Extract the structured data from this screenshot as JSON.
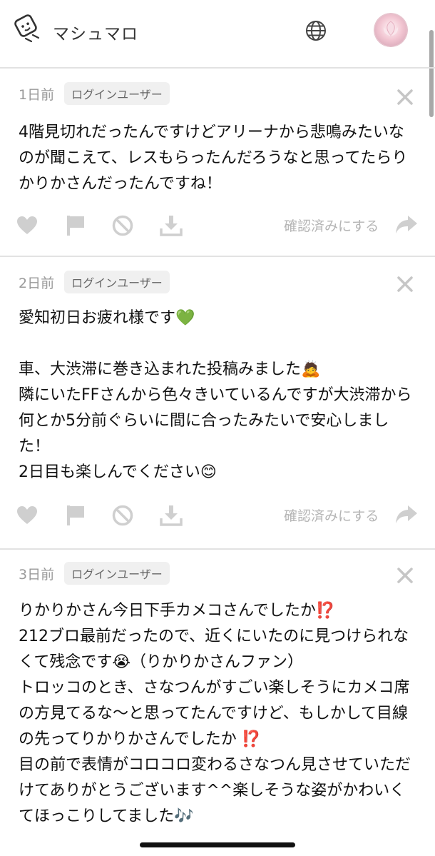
{
  "app": {
    "title": "マシュマロ"
  },
  "messages": [
    {
      "time": "1日前",
      "badge": "ログインユーザー",
      "text": "4階見切れだったんですけどアリーナから悲鳴みたいなのが聞こえて、レスもらったんだろうなと思ってたらりかりかさんだったんですね！",
      "confirm_label": "確認済みにする"
    },
    {
      "time": "2日前",
      "badge": "ログインユーザー",
      "text": "愛知初日お疲れ様です💚\n\n車、大渋滞に巻き込まれた投稿みました🙇\n隣にいたFFさんから色々きいているんですが大渋滞から何とか5分前ぐらいに間に合ったみたいで安心しました！\n2日目も楽しんでください😊",
      "confirm_label": "確認済みにする"
    },
    {
      "time": "3日前",
      "badge": "ログインユーザー",
      "text": "りかりかさん今日下手カメコさんでしたか⁉️\n212ブロ最前だったので、近くにいたのに見つけられなくて残念です😭（りかりかさんファン）\nトロッコのとき、さなつんがすごい楽しそうにカメコ席の方見てるな〜と思ってたんですけど、もしかして目線の先ってりかりかさんでしたか ⁉️\n目の前で表情がコロコロ変わるさなつん見させていただけてありがとうございます^^楽しそうな姿がかわいくてほっこりしてました🎶",
      "confirm_label": ""
    }
  ],
  "icons": {
    "heart": "heart-icon",
    "flag": "flag-icon",
    "block": "block-icon",
    "download": "download-icon",
    "share": "share-icon",
    "close": "close-icon",
    "globe": "globe-icon"
  },
  "colors": {
    "action_icon": "#cfcfcf",
    "muted_text": "#9a9a9a"
  }
}
